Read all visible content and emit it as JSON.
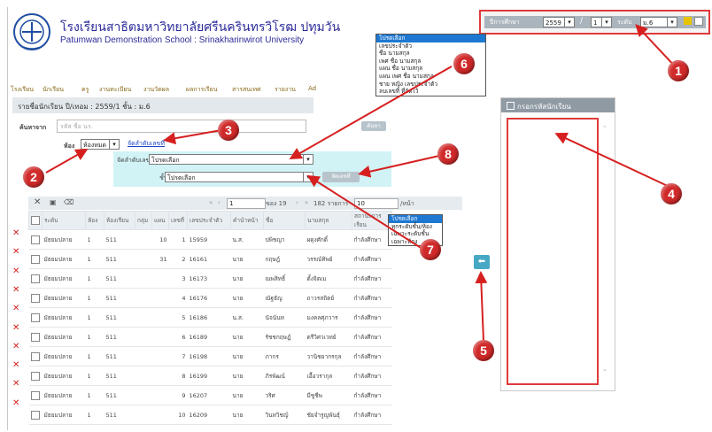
{
  "header": {
    "school_name_th": "โรงเรียนสาธิตมหาวิทยาลัยศรีนครินทรวิโรฒ ปทุมวัน",
    "school_name_en": "Patumwan Demonstration School : Srinakharinwirot University"
  },
  "topbar": {
    "year_label": "ปีการศึกษา",
    "year_value": "2559",
    "separator": "/",
    "term_value": "1",
    "level_label": "ระดับ",
    "level_value": "ม.6"
  },
  "menu": [
    "โรงเรียน",
    "นักเรียน",
    "ครู",
    "งานทะเบียน",
    "งานวัดผล",
    "ผลการเรียน",
    "สารสนเทศ",
    "รายงาน",
    "Ad"
  ],
  "breadcrumb": {
    "text": "รายชื่อนักเรียน   ปี/เทอม : 2559/1  ชั้น : ม.6"
  },
  "search": {
    "label": "ค้นหาจาก",
    "placeholder": "รหัส ชื่อ นร.",
    "button": "ค้นหา"
  },
  "room": {
    "label": "ห้อง",
    "value": "ห้องหมด",
    "sort_link": "จัดลำดับเลขที่"
  },
  "sort_panel": {
    "sort_by_label": "จัดลำดับเลขที่  โดยเรียงจาก",
    "sort_by_value": "โปรดเลือก",
    "class_label": "ชั้น/ห้อง",
    "class_value": "โปรดเลือก",
    "save_button": "จัดเลขที่"
  },
  "sort_by_dropdown": {
    "options": [
      "โปรดเลือก",
      "เลขประจำตัว",
      "ชื่อ  นามสกุล",
      "เพศ  ชื่อ  นามสกุล",
      "แผน  ชื่อ  นามสกุล",
      "แผน  เพศ  ชื่อ  นามสกุล",
      "ชาย  หญิง  เลขประจำตัว",
      "ลบเลขที่  ที่จัดไว้"
    ],
    "selected": "โปรดเลือก"
  },
  "class_dropdown": {
    "options": [
      "โปรดเลือก",
      "ทุกระดับชั้น/ห้อง",
      "เฉพาะระดับชั้น",
      "เฉพาะห้อง"
    ],
    "selected": "โปรดเลือก"
  },
  "pager": {
    "page_value": "1",
    "of_text": "ของ 19",
    "total_text": "182 รายการ",
    "per_page_value": "10",
    "per_page_label": "/หน้า"
  },
  "table": {
    "columns": [
      "ระดับ",
      "ห้อง",
      "ห้องเรียน",
      "กลุ่ม",
      "แผน",
      "เลขที่",
      "เลขประจำตัว",
      "คำนำหน้า",
      "ชื่อ",
      "นามสกุล",
      "สถานะการเรียน"
    ],
    "rows": [
      {
        "level": "มัธยมปลาย",
        "room": "1",
        "classroom": "511",
        "group": "",
        "plan": "10",
        "no": "1",
        "id": "15959",
        "prefix": "น.ส.",
        "first": "ปพิชญา",
        "last": "ผดุงศักดิ์",
        "status": "กำลังศึกษา"
      },
      {
        "level": "มัธยมปลาย",
        "room": "1",
        "classroom": "511",
        "group": "",
        "plan": "31",
        "no": "2",
        "id": "16161",
        "prefix": "นาย",
        "first": "กฤษฎ์",
        "last": "วรรณ์ทิพย์",
        "status": "กำลังศึกษา"
      },
      {
        "level": "มัธยมปลาย",
        "room": "1",
        "classroom": "511",
        "group": "",
        "plan": "",
        "no": "3",
        "id": "16173",
        "prefix": "นาย",
        "first": "ณพสิทธิ์",
        "last": "ตั้งจิตเม",
        "status": "กำลังศึกษา"
      },
      {
        "level": "มัธยมปลาย",
        "room": "1",
        "classroom": "511",
        "group": "",
        "plan": "",
        "no": "4",
        "id": "16176",
        "prefix": "นาย",
        "first": "ณัฐธัญ",
        "last": "ถาวรสถิตย์",
        "status": "กำลังศึกษา"
      },
      {
        "level": "มัธยมปลาย",
        "room": "1",
        "classroom": "511",
        "group": "",
        "plan": "",
        "no": "5",
        "id": "16186",
        "prefix": "น.ส.",
        "first": "นัจนันท",
        "last": "มงคลศุภวาร",
        "status": "กำลังศึกษา"
      },
      {
        "level": "มัธยมปลาย",
        "room": "1",
        "classroom": "511",
        "group": "",
        "plan": "",
        "no": "6",
        "id": "16189",
        "prefix": "นาย",
        "first": "รัชชกฤษฎ์",
        "last": "ตรีวิศวเวทย์",
        "status": "กำลังศึกษา"
      },
      {
        "level": "มัธยมปลาย",
        "room": "1",
        "classroom": "511",
        "group": "",
        "plan": "",
        "no": "7",
        "id": "16198",
        "prefix": "นาย",
        "first": "ภากร",
        "last": "วานิชยากรกุล",
        "status": "กำลังศึกษา"
      },
      {
        "level": "มัธยมปลาย",
        "room": "1",
        "classroom": "511",
        "group": "",
        "plan": "",
        "no": "8",
        "id": "16199",
        "prefix": "นาย",
        "first": "ภิรพัฒน์",
        "last": "เอื้อวรากุล",
        "status": "กำลังศึกษา"
      },
      {
        "level": "มัธยมปลาย",
        "room": "1",
        "classroom": "511",
        "group": "",
        "plan": "",
        "no": "9",
        "id": "16207",
        "prefix": "นาย",
        "first": "วริศ",
        "last": "มีชูชีพ",
        "status": "กำลังศึกษา"
      },
      {
        "level": "มัธยมปลาย",
        "room": "1",
        "classroom": "511",
        "group": "",
        "plan": "",
        "no": "10",
        "id": "16209",
        "prefix": "นาย",
        "first": "วินทวิชญ์",
        "last": "ชัยจำรูญพันธุ์",
        "status": "กำลังศึกษา"
      }
    ]
  },
  "right_panel": {
    "title": "กรอกรหัสนักเรียน"
  },
  "callouts": [
    "1",
    "2",
    "3",
    "4",
    "5",
    "6",
    "7",
    "8"
  ],
  "colors": {
    "callout_red": "#d12a2a",
    "highlight_border": "#e03a3a",
    "selection_blue": "#1e78d2",
    "school_text": "#2b2b9a"
  }
}
